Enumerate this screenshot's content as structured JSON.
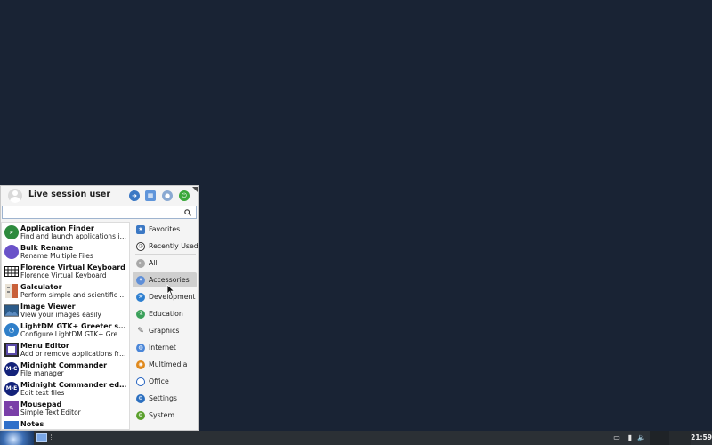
{
  "menu": {
    "user": "Live session user",
    "header_buttons": [
      {
        "icon": "switch-user-icon"
      },
      {
        "icon": "settings-manager-icon"
      },
      {
        "icon": "lock-screen-icon"
      },
      {
        "icon": "log-out-icon"
      }
    ],
    "search": {
      "value": "",
      "placeholder": "",
      "icon": "search-icon"
    },
    "apps": [
      {
        "name": "Application Finder",
        "desc": "Find and launch applications in...",
        "icon": "search-icon",
        "color": "#2e8b3e"
      },
      {
        "name": "Bulk Rename",
        "desc": "Rename Multiple Files",
        "icon": "rename-icon",
        "color": "#6a52c9"
      },
      {
        "name": "Florence Virtual Keyboard",
        "desc": "Florence Virtual Keyboard",
        "icon": "keyboard-icon",
        "color": "#222222"
      },
      {
        "name": "Galculator",
        "desc": "Perform simple and scientific c...",
        "icon": "calculator-icon",
        "color": "#c9603a"
      },
      {
        "name": "Image Viewer",
        "desc": "View your images easily",
        "icon": "image-icon",
        "color": "#2b5b8a"
      },
      {
        "name": "LightDM GTK+ Greeter set...",
        "desc": "Configure LightDM GTK+ Greeter",
        "icon": "greeter-icon",
        "color": "#2f7fc9"
      },
      {
        "name": "Menu Editor",
        "desc": "Add or remove applications fro...",
        "icon": "menu-editor-icon",
        "color": "#5a4aa8"
      },
      {
        "name": "Midnight Commander",
        "desc": "File manager",
        "icon": "midnight-commander-icon",
        "color": "#13227a"
      },
      {
        "name": "Midnight Commander editor",
        "desc": "Edit text files",
        "icon": "midnight-commander-icon",
        "color": "#13227a"
      },
      {
        "name": "Mousepad",
        "desc": "Simple Text Editor",
        "icon": "text-editor-icon",
        "color": "#7a3fa8"
      },
      {
        "name": "Notes",
        "desc": "",
        "icon": "notes-icon",
        "color": "#2f6fc9"
      }
    ],
    "categories": [
      {
        "label": "Favorites",
        "icon": "favorites-icon",
        "color": "#3b78c4"
      },
      {
        "label": "Recently Used",
        "icon": "recent-icon",
        "color": "#333333"
      },
      {
        "label": "All",
        "icon": "all-icon",
        "color": "#a8a8a8"
      },
      {
        "label": "Accessories",
        "icon": "accessories-icon",
        "color": "#5f8fd8",
        "active": true
      },
      {
        "label": "Development",
        "icon": "development-icon",
        "color": "#2d7fd0"
      },
      {
        "label": "Education",
        "icon": "education-icon",
        "color": "#3aa05a"
      },
      {
        "label": "Graphics",
        "icon": "graphics-icon",
        "color": "#555555"
      },
      {
        "label": "Internet",
        "icon": "internet-icon",
        "color": "#4a86d8"
      },
      {
        "label": "Multimedia",
        "icon": "multimedia-icon",
        "color": "#e08a1e"
      },
      {
        "label": "Office",
        "icon": "office-icon",
        "color": "#1f5fbf"
      },
      {
        "label": "Settings",
        "icon": "settings-icon",
        "color": "#2b6fbf"
      },
      {
        "label": "System",
        "icon": "system-icon",
        "color": "#5aa02c"
      }
    ]
  },
  "taskbar": {
    "clock": "21:59",
    "tray": [
      {
        "icon": "display-icon"
      },
      {
        "icon": "clipboard-icon"
      },
      {
        "icon": "volume-icon"
      }
    ]
  }
}
